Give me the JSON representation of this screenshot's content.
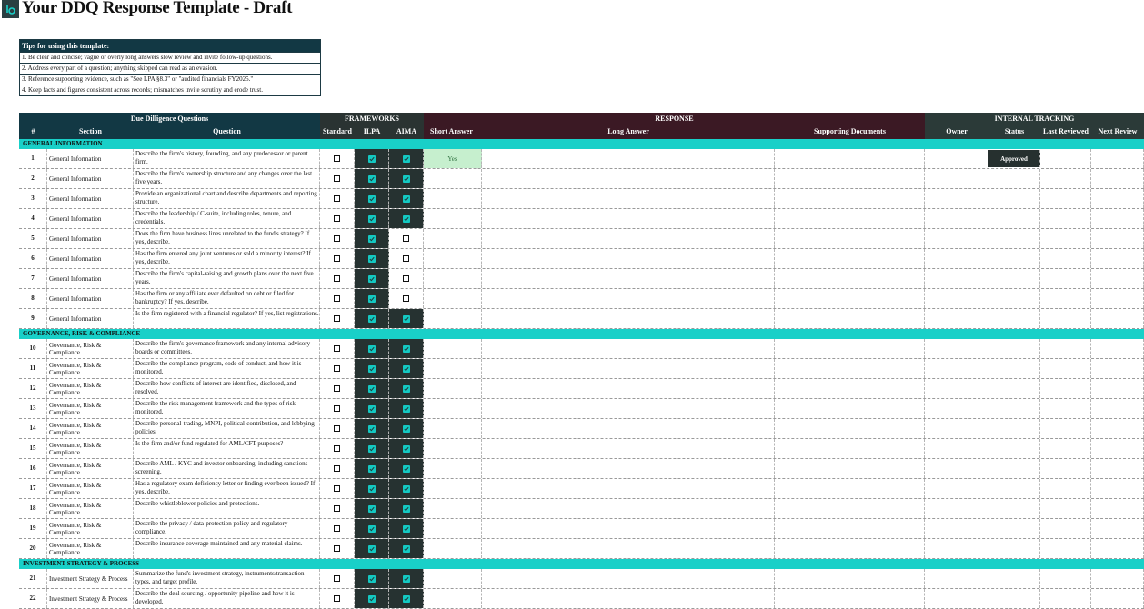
{
  "header": {
    "title": "Your DDQ Response Template - Draft",
    "logo_icon": "logo-icon"
  },
  "tips": {
    "heading": "Tips for using this template:",
    "items": [
      "1. Be clear and concise; vague or overly long answers slow review and invite follow-up questions.",
      "2. Address every part of a question; anything skipped can read as an evasion.",
      "3. Reference supporting evidence, such as \"See LPA §8.3\" or \"audited financials FY2025.\"",
      "4. Keep facts and figures consistent across records; mismatches invite scrutiny and erode trust."
    ]
  },
  "groups": {
    "due_diligence": "Due Dilligence Questions",
    "frameworks": "FRAMEWORKS",
    "response": "RESPONSE",
    "internal": "INTERNAL TRACKING"
  },
  "columns": {
    "num": "#",
    "section": "Section",
    "question": "Question",
    "standard": "Standard",
    "ilpa": "ILPA",
    "aima": "AIMA",
    "short_answer": "Short Answer",
    "long_answer": "Long Answer",
    "supporting_docs": "Supporting Documents",
    "owner": "Owner",
    "status": "Status",
    "last_reviewed": "Last Reviewed",
    "next_review": "Next Review"
  },
  "colors": {
    "section_band": "#19d0c8",
    "checked": "#14c9c2",
    "header_teal": "#123844",
    "header_wine": "#3b1924"
  },
  "sections": [
    {
      "title": "GENERAL INFORMATION",
      "rows": [
        {
          "num": "1",
          "section": "General Information",
          "question": "Describe the firm's history, founding, and any predecessor or parent firm.",
          "standard": false,
          "ilpa": true,
          "aima": true,
          "short_answer": "Yes",
          "status": "Approved"
        },
        {
          "num": "2",
          "section": "General Information",
          "question": "Describe the firm's ownership structure and any changes over the last five years.",
          "standard": false,
          "ilpa": true,
          "aima": true,
          "short_answer": "",
          "status": ""
        },
        {
          "num": "3",
          "section": "General Information",
          "question": "Provide an organizational chart and describe departments and reporting structure.",
          "standard": false,
          "ilpa": true,
          "aima": true,
          "short_answer": "",
          "status": ""
        },
        {
          "num": "4",
          "section": "General Information",
          "question": "Describe the leadership / C-suite, including roles, tenure, and credentials.",
          "standard": false,
          "ilpa": true,
          "aima": true,
          "short_answer": "",
          "status": ""
        },
        {
          "num": "5",
          "section": "General Information",
          "question": "Does the firm have business lines unrelated to the fund's strategy? If yes, describe.",
          "standard": false,
          "ilpa": true,
          "aima": false,
          "short_answer": "",
          "status": ""
        },
        {
          "num": "6",
          "section": "General Information",
          "question": "Has the firm entered any joint ventures or sold a minority interest? If yes, describe.",
          "standard": false,
          "ilpa": true,
          "aima": false,
          "short_answer": "",
          "status": ""
        },
        {
          "num": "7",
          "section": "General Information",
          "question": "Describe the firm's capital-raising and growth plans over the next five years.",
          "standard": false,
          "ilpa": true,
          "aima": false,
          "short_answer": "",
          "status": ""
        },
        {
          "num": "8",
          "section": "General Information",
          "question": "Has the firm or any affiliate ever defaulted on debt or filed for bankruptcy? If yes, describe.",
          "standard": false,
          "ilpa": true,
          "aima": false,
          "short_answer": "",
          "status": ""
        },
        {
          "num": "9",
          "section": "General Information",
          "question": "Is the firm registered with a financial regulator? If yes, list registrations.",
          "standard": false,
          "ilpa": true,
          "aima": true,
          "short_answer": "",
          "status": ""
        }
      ]
    },
    {
      "title": "GOVERNANCE, RISK & COMPLIANCE",
      "rows": [
        {
          "num": "10",
          "section": "Governance, Risk & Compliance",
          "question": "Describe the firm's governance framework and any internal advisory boards or committees.",
          "standard": false,
          "ilpa": true,
          "aima": true,
          "short_answer": "",
          "status": ""
        },
        {
          "num": "11",
          "section": "Governance, Risk & Compliance",
          "question": "Describe the compliance program, code of conduct, and how it is monitored.",
          "standard": false,
          "ilpa": true,
          "aima": true,
          "short_answer": "",
          "status": ""
        },
        {
          "num": "12",
          "section": "Governance, Risk & Compliance",
          "question": "Describe how conflicts of interest are identified, disclosed, and resolved.",
          "standard": false,
          "ilpa": true,
          "aima": true,
          "short_answer": "",
          "status": ""
        },
        {
          "num": "13",
          "section": "Governance, Risk & Compliance",
          "question": "Describe the risk management framework and the types of risk monitored.",
          "standard": false,
          "ilpa": true,
          "aima": true,
          "short_answer": "",
          "status": ""
        },
        {
          "num": "14",
          "section": "Governance, Risk & Compliance",
          "question": "Describe personal-trading, MNPI, political-contribution, and lobbying policies.",
          "standard": false,
          "ilpa": true,
          "aima": true,
          "short_answer": "",
          "status": ""
        },
        {
          "num": "15",
          "section": "Governance, Risk & Compliance",
          "question": "Is the firm and/or fund regulated for AML/CFT purposes?",
          "standard": false,
          "ilpa": true,
          "aima": true,
          "short_answer": "",
          "status": ""
        },
        {
          "num": "16",
          "section": "Governance, Risk & Compliance",
          "question": "Describe AML / KYC and investor onboarding, including sanctions screening.",
          "standard": false,
          "ilpa": true,
          "aima": true,
          "short_answer": "",
          "status": ""
        },
        {
          "num": "17",
          "section": "Governance, Risk & Compliance",
          "question": "Has a regulatory exam deficiency letter or finding ever been issued? If yes, describe.",
          "standard": false,
          "ilpa": true,
          "aima": true,
          "short_answer": "",
          "status": ""
        },
        {
          "num": "18",
          "section": "Governance, Risk & Compliance",
          "question": "Describe whistleblower policies and protections.",
          "standard": false,
          "ilpa": true,
          "aima": true,
          "short_answer": "",
          "status": ""
        },
        {
          "num": "19",
          "section": "Governance, Risk & Compliance",
          "question": "Describe the privacy / data-protection policy and regulatory compliance.",
          "standard": false,
          "ilpa": true,
          "aima": true,
          "short_answer": "",
          "status": ""
        },
        {
          "num": "20",
          "section": "Governance, Risk & Compliance",
          "question": "Describe insurance coverage maintained and any material claims.",
          "standard": false,
          "ilpa": true,
          "aima": true,
          "short_answer": "",
          "status": ""
        }
      ]
    },
    {
      "title": "INVESTMENT STRATEGY & PROCESS",
      "rows": [
        {
          "num": "21",
          "section": "Investment Strategy & Process",
          "question": "Summarize the fund's investment strategy, instruments/transaction types, and target profile.",
          "standard": false,
          "ilpa": true,
          "aima": true,
          "short_answer": "",
          "status": ""
        },
        {
          "num": "22",
          "section": "Investment Strategy & Process",
          "question": "Describe the deal sourcing / opportunity pipeline and how it is developed.",
          "standard": false,
          "ilpa": true,
          "aima": true,
          "short_answer": "",
          "status": ""
        }
      ]
    }
  ]
}
